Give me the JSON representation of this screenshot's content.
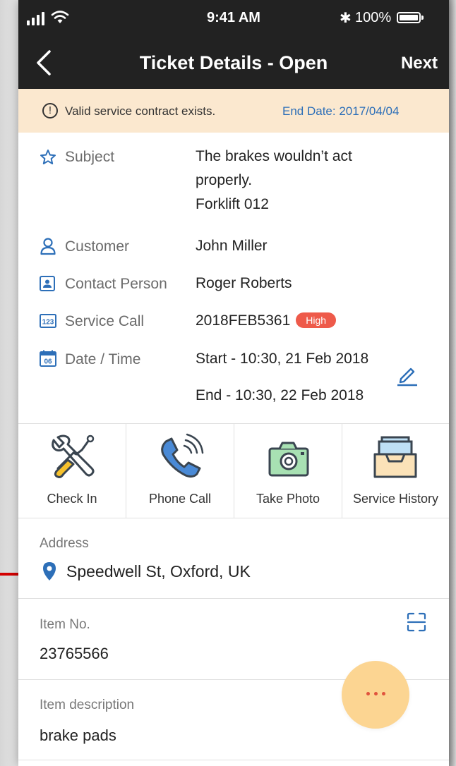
{
  "status_bar": {
    "time": "9:41 AM",
    "battery": "100%"
  },
  "nav": {
    "title": "Ticket Details - Open",
    "next_label": "Next"
  },
  "banner": {
    "message": "Valid service contract exists.",
    "end_date": "End Date: 2017/04/04"
  },
  "details": {
    "subject": {
      "label": "Subject",
      "lines": [
        "The brakes wouldn’t act",
        "properly.",
        "Forklift 012"
      ],
      "icon": "star-icon"
    },
    "customer": {
      "label": "Customer",
      "value": "John Miller",
      "icon": "person-icon"
    },
    "contact": {
      "label": "Contact Person",
      "value": "Roger Roberts",
      "icon": "contact-card-icon"
    },
    "service_call": {
      "label": "Service Call",
      "value": "2018FEB5361",
      "priority": "High",
      "icon": "number-icon"
    },
    "datetime": {
      "label": "Date / Time",
      "start": "Start - 10:30, 21 Feb 2018",
      "end": "End - 10:30, 22 Feb 2018",
      "icon": "calendar-icon",
      "calendar_day": "06"
    }
  },
  "actions": [
    {
      "label": "Check In",
      "icon": "tools-icon"
    },
    {
      "label": "Phone Call",
      "icon": "phone-icon"
    },
    {
      "label": "Take Photo",
      "icon": "camera-icon"
    },
    {
      "label": "Service History",
      "icon": "inbox-tray-icon"
    }
  ],
  "address": {
    "label": "Address",
    "value": "Speedwell St, Oxford, UK"
  },
  "item_no": {
    "label": "Item No.",
    "value": "23765566"
  },
  "item_description": {
    "label": "Item description",
    "value": "brake pads"
  },
  "colors": {
    "nav_bg": "#222222",
    "banner_bg": "#fbe8cf",
    "accent_blue": "#2d6fb8",
    "badge_red": "#ee5a4a",
    "fab_bg": "#fcd592",
    "annotation_red": "#d40000"
  }
}
